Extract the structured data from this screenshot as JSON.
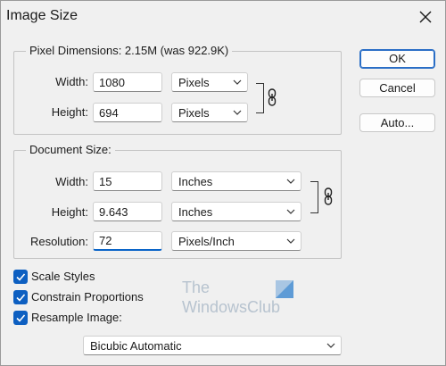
{
  "window": {
    "title": "Image Size"
  },
  "buttons": {
    "ok": "OK",
    "cancel": "Cancel",
    "auto": "Auto..."
  },
  "pixel_dimensions": {
    "legend": "Pixel Dimensions:  2.15M (was 922.9K)",
    "width_label": "Width:",
    "width_value": "1080",
    "width_unit": "Pixels",
    "height_label": "Height:",
    "height_value": "694",
    "height_unit": "Pixels"
  },
  "document_size": {
    "legend": "Document Size:",
    "width_label": "Width:",
    "width_value": "15",
    "width_unit": "Inches",
    "height_label": "Height:",
    "height_value": "9.643",
    "height_unit": "Inches",
    "resolution_label": "Resolution:",
    "resolution_value": "72",
    "resolution_unit": "Pixels/Inch"
  },
  "options": {
    "scale_styles": {
      "label": "Scale Styles",
      "checked": true
    },
    "constrain_proportions": {
      "label": "Constrain Proportions",
      "checked": true
    },
    "resample_image": {
      "label": "Resample Image:",
      "checked": true
    },
    "resample_method": "Bicubic Automatic"
  },
  "watermark": {
    "line1": "The",
    "line2": "WindowsClub"
  },
  "colors": {
    "checkbox_accent": "#0d5fc1",
    "default_button_border": "#2a6ec6",
    "active_field_underline": "#0a64c8"
  },
  "icons": {
    "close": "close-icon",
    "chain_link": "chain-link-icon",
    "chevron": "chevron-down-icon",
    "checkmark": "checkmark-icon"
  }
}
